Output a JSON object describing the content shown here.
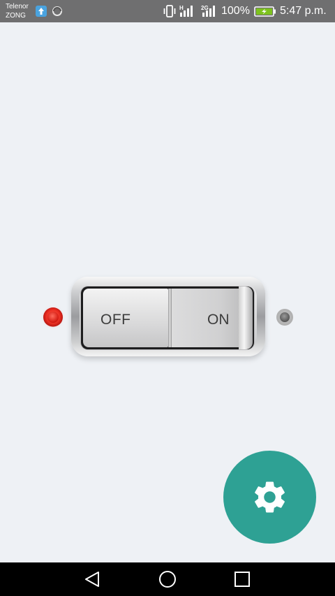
{
  "status_bar": {
    "carrier_1": "Telenor",
    "carrier_2": "ZONG",
    "net_h": "H",
    "net_2g": "2G",
    "battery_percent": "100%",
    "time": "5:47 p.m.",
    "icons": [
      "upload-icon",
      "sync-icon",
      "vibrate-icon",
      "signal-h-icon",
      "signal-2g-icon",
      "battery-charging-icon"
    ]
  },
  "switch": {
    "off_label": "OFF",
    "on_label": "ON",
    "state": "off"
  },
  "indicators": {
    "left": {
      "icon": "red-led-icon",
      "color": "#e3231a",
      "lit": true
    },
    "right": {
      "icon": "grey-led-icon",
      "color": "#555555",
      "lit": false
    }
  },
  "fab": {
    "icon": "gear-icon",
    "color": "#2ea194"
  },
  "nav_bar": {
    "buttons": [
      "back-icon",
      "home-icon",
      "recents-icon"
    ]
  }
}
